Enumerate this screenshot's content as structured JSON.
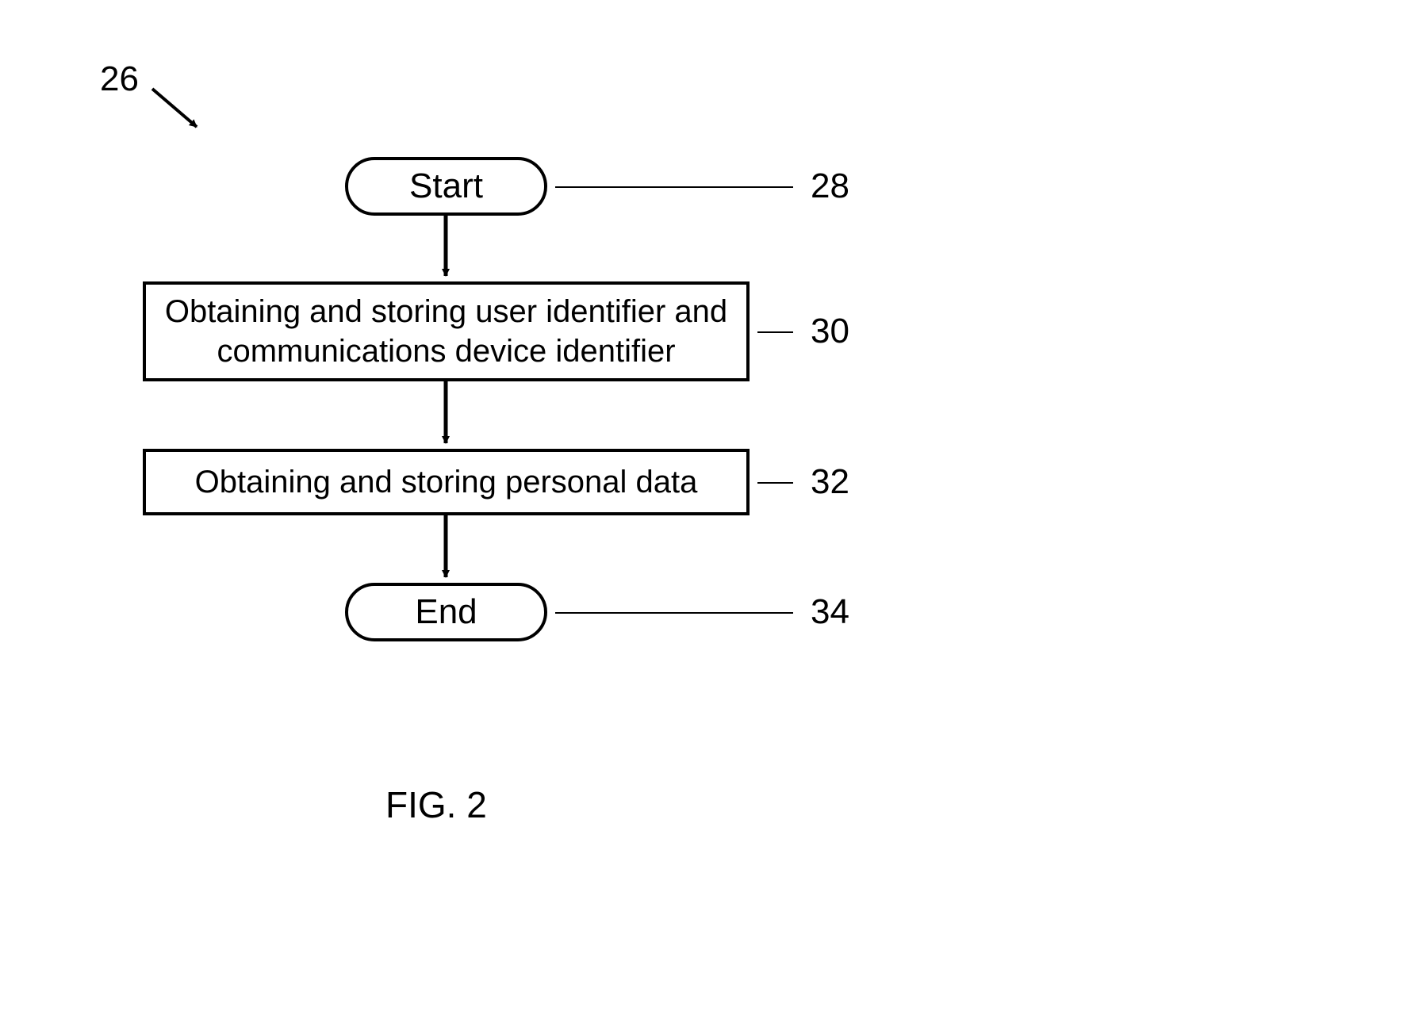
{
  "refs": {
    "figure": "26",
    "start": "28",
    "step1": "30",
    "step2": "32",
    "end": "34"
  },
  "nodes": {
    "start": "Start",
    "step1": "Obtaining and storing user identifier and communications device identifier",
    "step2": "Obtaining and storing personal data",
    "end": "End"
  },
  "caption": "FIG. 2"
}
